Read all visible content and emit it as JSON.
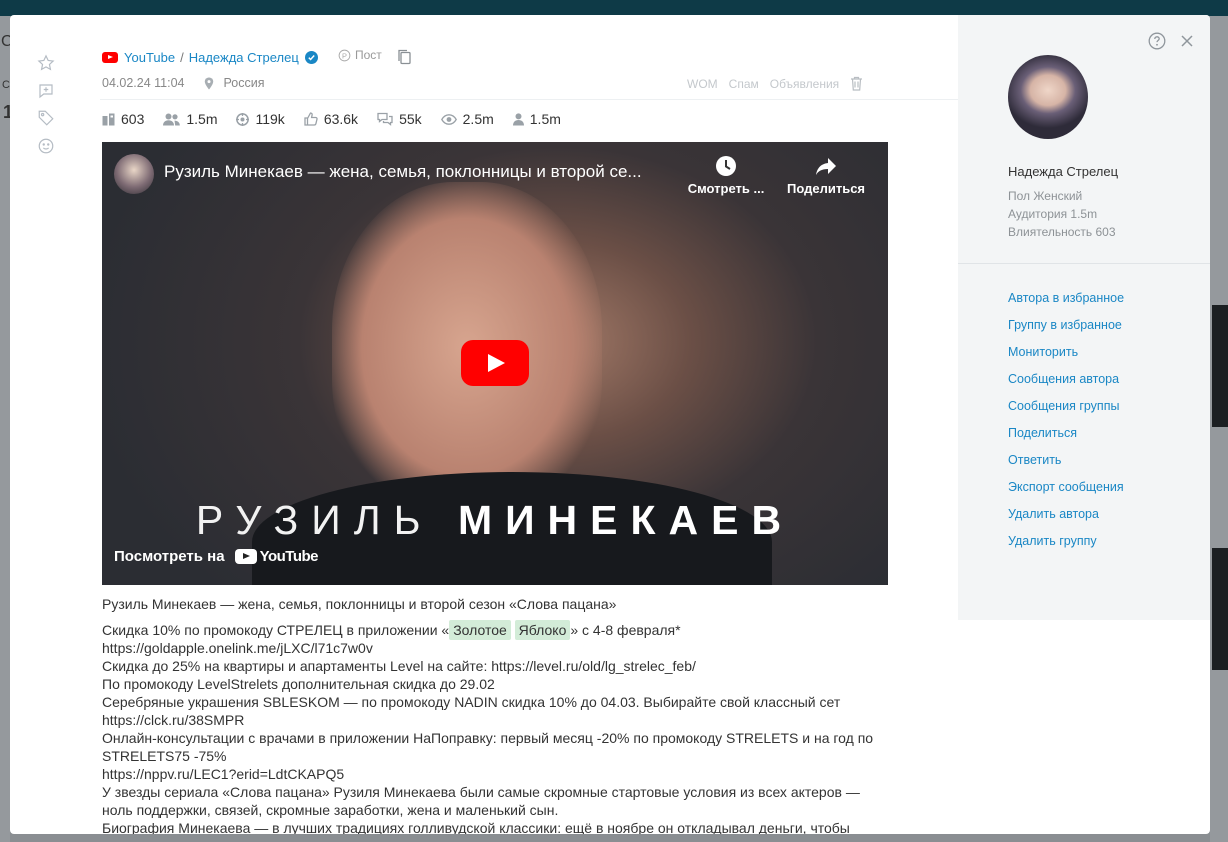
{
  "background": {
    "fragments": [
      "С",
      "С",
      "1"
    ]
  },
  "post": {
    "source": "YouTube",
    "author": "Надежда Стрелец",
    "type_label": "Пост",
    "datetime": "04.02.24 11:04",
    "location": "Россия",
    "actions": [
      "WOM",
      "Спам",
      "Объявления"
    ],
    "stats": [
      {
        "icon": "influence-icon",
        "value": "603"
      },
      {
        "icon": "audience-icon",
        "value": "1.5m"
      },
      {
        "icon": "reach-icon",
        "value": "119k"
      },
      {
        "icon": "likes-icon",
        "value": "63.6k"
      },
      {
        "icon": "comments-icon",
        "value": "55k"
      },
      {
        "icon": "views-icon",
        "value": "2.5m"
      },
      {
        "icon": "subscribers-icon",
        "value": "1.5m"
      }
    ]
  },
  "video": {
    "title": "Рузиль Минекаев — жена, семья, поклонницы и второй се...",
    "watch_later": "Смотреть ...",
    "share": "Поделиться",
    "overlay_name_first": "РУЗИЛЬ",
    "overlay_name_last": "МИНЕКАЕВ",
    "watch_on": "Посмотреть на",
    "platform": "YouTube"
  },
  "text": {
    "title_line": "Рузиль Минекаев — жена, семья, поклонницы и второй сезон «Слова пацана»",
    "promo_prefix": "Скидка 10% по промокоду СТРЕЛЕЦ в приложении «",
    "promo_hl1": "Золотое",
    "promo_hl2": "Яблоко",
    "promo_suffix": "» с 4-8 февраля*",
    "lines": [
      "https://goldapple.onelink.me/jLXC/l71c7w0v",
      "Скидка до 25% на квартиры и апартаменты Level на сайте: https://level.ru/old/lg_strelec_feb/",
      "По промокоду LevelStrelets дополнительная скидка до 29.02",
      "Серебряные украшения SBLESKOM — по промокоду NADIN скидка 10% до 04.03. Выбирайте свой классный сет",
      "https://clck.ru/38SMPR",
      "Онлайн-консультации с врачами в приложении НаПоправку: первый месяц -20% по промокоду STRELETS и на год по",
      "STRELETS75 -75%",
      "https://nppv.ru/LEC1?erid=LdtCKAPQ5",
      "У звезды сериала «Слова пацана» Рузиля Минекаева были самые скромные стартовые условия из всех актеров —",
      "ноль поддержки, связей, скромные заработки, жена и маленький сын.",
      "Биография Минекаева — в лучших традициях голливудской классики: ещё в ноябре он откладывал деньги, чтобы"
    ]
  },
  "profile": {
    "name": "Надежда Стрелец",
    "gender": "Пол Женский",
    "audience": "Аудитория 1.5m",
    "influence": "Влиятельность 603",
    "actions": [
      "Автора в избранное",
      "Группу в избранное",
      "Мониторить",
      "Сообщения автора",
      "Сообщения группы",
      "Поделиться",
      "Ответить",
      "Экспорт сообщения",
      "Удалить автора",
      "Удалить группу"
    ]
  },
  "colors": {
    "link": "#1a87c5",
    "highlight": "#d3ecd8",
    "youtube_red": "#ff0000"
  }
}
